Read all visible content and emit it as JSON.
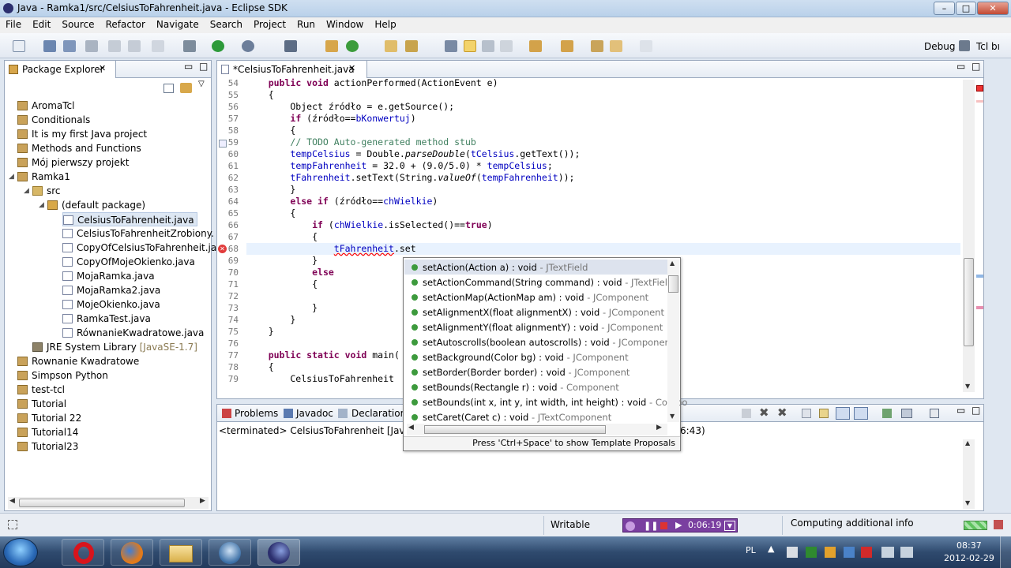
{
  "window": {
    "title": "Java - Ramka1/src/CelsiusToFahrenheit.java - Eclipse SDK"
  },
  "menu": [
    "File",
    "Edit",
    "Source",
    "Refactor",
    "Navigate",
    "Search",
    "Project",
    "Run",
    "Window",
    "Help"
  ],
  "perspectives": {
    "debug": "Debug",
    "tcl": "Tcl bı"
  },
  "package_explorer": {
    "title": "Package Explorer",
    "items": [
      {
        "label": "AromaTcl",
        "type": "proj",
        "depth": 0,
        "expander": ""
      },
      {
        "label": "Conditionals",
        "type": "proj",
        "depth": 0,
        "expander": ""
      },
      {
        "label": "It is my first Java project",
        "type": "proj",
        "depth": 0,
        "expander": ""
      },
      {
        "label": "Methods and Functions",
        "type": "proj",
        "depth": 0,
        "expander": ""
      },
      {
        "label": "Mój pierwszy projekt",
        "type": "proj",
        "depth": 0,
        "expander": ""
      },
      {
        "label": "Ramka1",
        "type": "proj",
        "depth": 0,
        "expander": "open"
      },
      {
        "label": "src",
        "type": "folder",
        "depth": 1,
        "expander": "open"
      },
      {
        "label": "(default package)",
        "type": "pkg",
        "depth": 2,
        "expander": "open"
      },
      {
        "label": "CelsiusToFahrenheit.java",
        "type": "jf",
        "depth": 3,
        "expander": "",
        "selected": true
      },
      {
        "label": "CelsiusToFahrenheitZrobiony.",
        "type": "jf",
        "depth": 3,
        "expander": ""
      },
      {
        "label": "CopyOfCelsiusToFahrenheit.ja",
        "type": "jf",
        "depth": 3,
        "expander": ""
      },
      {
        "label": "CopyOfMojeOkienko.java",
        "type": "jf",
        "depth": 3,
        "expander": ""
      },
      {
        "label": "MojaRamka.java",
        "type": "jf",
        "depth": 3,
        "expander": ""
      },
      {
        "label": "MojaRamka2.java",
        "type": "jf",
        "depth": 3,
        "expander": ""
      },
      {
        "label": "MojeOkienko.java",
        "type": "jf",
        "depth": 3,
        "expander": ""
      },
      {
        "label": "RamkaTest.java",
        "type": "jf",
        "depth": 3,
        "expander": ""
      },
      {
        "label": "RównanieKwadratowe.java",
        "type": "jf",
        "depth": 3,
        "expander": ""
      },
      {
        "label": "JRE System Library",
        "suffix": "[JavaSE-1.7]",
        "type": "lib",
        "depth": 1,
        "expander": ""
      },
      {
        "label": "Rownanie Kwadratowe",
        "type": "proj",
        "depth": 0,
        "expander": ""
      },
      {
        "label": "Simpson Python",
        "type": "proj",
        "depth": 0,
        "expander": ""
      },
      {
        "label": "test-tcl",
        "type": "proj",
        "depth": 0,
        "expander": ""
      },
      {
        "label": "Tutorial",
        "type": "proj",
        "depth": 0,
        "expander": ""
      },
      {
        "label": "Tutorial 22",
        "type": "proj",
        "depth": 0,
        "expander": ""
      },
      {
        "label": "Tutorial14",
        "type": "proj",
        "depth": 0,
        "expander": ""
      },
      {
        "label": "Tutorial23",
        "type": "proj",
        "depth": 0,
        "expander": ""
      }
    ]
  },
  "editor": {
    "tab": "*CelsiusToFahrenheit.java",
    "lines": [
      {
        "n": "54",
        "html": "    <span class='kw'>public void</span> actionPerformed(ActionEvent e)"
      },
      {
        "n": "55",
        "html": "    {"
      },
      {
        "n": "56",
        "html": "        Object źródło = e.getSource();"
      },
      {
        "n": "57",
        "html": "        <span class='kw'>if</span> (źródło==<span class='fld'>bKonwertuj</span>)"
      },
      {
        "n": "58",
        "html": "        {"
      },
      {
        "n": "59",
        "html": "        <span class='cm'>// TODO Auto-generated method stub</span>"
      },
      {
        "n": "60",
        "html": "        <span class='fld'>tempCelsius</span> = Double.<span class='it'>parseDouble</span>(<span class='fld'>tCelsius</span>.getText());"
      },
      {
        "n": "61",
        "html": "        <span class='fld'>tempFahrenheit</span> = 32.0 + (9.0/5.0) * <span class='fld'>tempCelsius</span>;"
      },
      {
        "n": "62",
        "html": "        <span class='fld'>tFahrenheit</span>.setText(String.<span class='it'>valueOf</span>(<span class='fld'>tempFahrenheit</span>));"
      },
      {
        "n": "63",
        "html": "        }"
      },
      {
        "n": "64",
        "html": "        <span class='kw'>else if</span> (źródło==<span class='fld'>chWielkie</span>)"
      },
      {
        "n": "65",
        "html": "        {"
      },
      {
        "n": "66",
        "html": "            <span class='kw'>if</span> (<span class='fld'>chWielkie</span>.isSelected()==<span class='kw'>true</span>)"
      },
      {
        "n": "67",
        "html": "            {"
      },
      {
        "n": "68",
        "html": "                <span class='fld' style='text-decoration:underline wavy red'>tFahrenheit</span>.set"
      },
      {
        "n": "69",
        "html": "            }"
      },
      {
        "n": "70",
        "html": "            <span class='kw'>else</span>"
      },
      {
        "n": "71",
        "html": "            {"
      },
      {
        "n": "72",
        "html": ""
      },
      {
        "n": "73",
        "html": "            }"
      },
      {
        "n": "74",
        "html": "        }"
      },
      {
        "n": "75",
        "html": "    }"
      },
      {
        "n": "76",
        "html": ""
      },
      {
        "n": "77",
        "html": "    <span class='kw'>public static void</span> main("
      },
      {
        "n": "78",
        "html": "    {"
      },
      {
        "n": "79",
        "html": "        CelsiusToFahrenheit"
      }
    ]
  },
  "autocomplete": {
    "items": [
      {
        "sig": "setAction(Action a) : void",
        "cls": " - JTextField"
      },
      {
        "sig": "setActionCommand(String command) : void",
        "cls": " - JTextField"
      },
      {
        "sig": "setActionMap(ActionMap am) : void",
        "cls": " - JComponent"
      },
      {
        "sig": "setAlignmentX(float alignmentX) : void",
        "cls": " - JComponent"
      },
      {
        "sig": "setAlignmentY(float alignmentY) : void",
        "cls": " - JComponent"
      },
      {
        "sig": "setAutoscrolls(boolean autoscrolls) : void",
        "cls": " - JComponent"
      },
      {
        "sig": "setBackground(Color bg) : void",
        "cls": " - JComponent"
      },
      {
        "sig": "setBorder(Border border) : void",
        "cls": " - JComponent"
      },
      {
        "sig": "setBounds(Rectangle r) : void",
        "cls": " - Component"
      },
      {
        "sig": "setBounds(int x, int y, int width, int height) : void",
        "cls": " - Compo"
      },
      {
        "sig": "setCaret(Caret c) : void",
        "cls": " - JTextComponent"
      }
    ],
    "footer": "Press 'Ctrl+Space' to show Template Proposals"
  },
  "bottom_panel": {
    "tabs": [
      "Problems",
      "Javadoc",
      "Declaration"
    ],
    "console_line": "<terminated> CelsiusToFahrenheit [Java App",
    "console_time": "6:43)"
  },
  "status": {
    "writable": "Writable",
    "recorder_time": "0:06:19",
    "computing": "Computing additional info"
  },
  "taskbar": {
    "lang": "PL",
    "time": "08:37",
    "date": "2012-02-29"
  }
}
